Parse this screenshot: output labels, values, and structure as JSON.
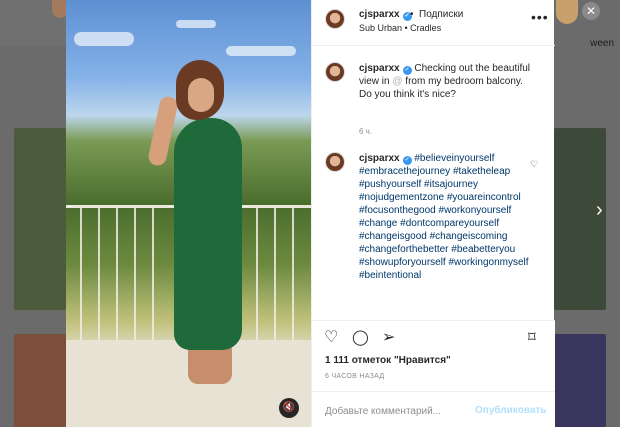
{
  "background": {
    "side_text": "ween"
  },
  "post": {
    "username": "cjsparxx",
    "follow_separator": "•",
    "follow_label": "Подписки",
    "audio": "Sub Urban • Cradles",
    "more_icon": "ellipsis-icon",
    "caption": {
      "username": "cjsparxx",
      "text": "Checking out the beautiful view in",
      "text_obscured": "@",
      "text_after": "from my bedroom balcony. Do you think it's nice?",
      "time": "6 ч."
    },
    "comment": {
      "username": "cjsparxx",
      "hashtags": "#believeinyourself #embracethejourney #taketheleap #pushyourself #itsajourney #nojudgementzone #youareincontrol #focusonthegood #workonyourself #change #dontcompareyourself #changeisgood #changeiscoming #changeforthebetter #beabetteryou #showupforyourself #workingonmyself #beintentional"
    },
    "likes": "1 111 отметок \"Нравится\"",
    "date": "6 ЧАСОВ НАЗАД",
    "add_comment_placeholder": "Добавьте комментарий...",
    "publish_label": "Опубликовать"
  },
  "icons": {
    "close": "✕",
    "next": "›",
    "mute": "🔇",
    "heart": "♡",
    "comment": "◯",
    "share": "➢",
    "bookmark": "⌑"
  }
}
